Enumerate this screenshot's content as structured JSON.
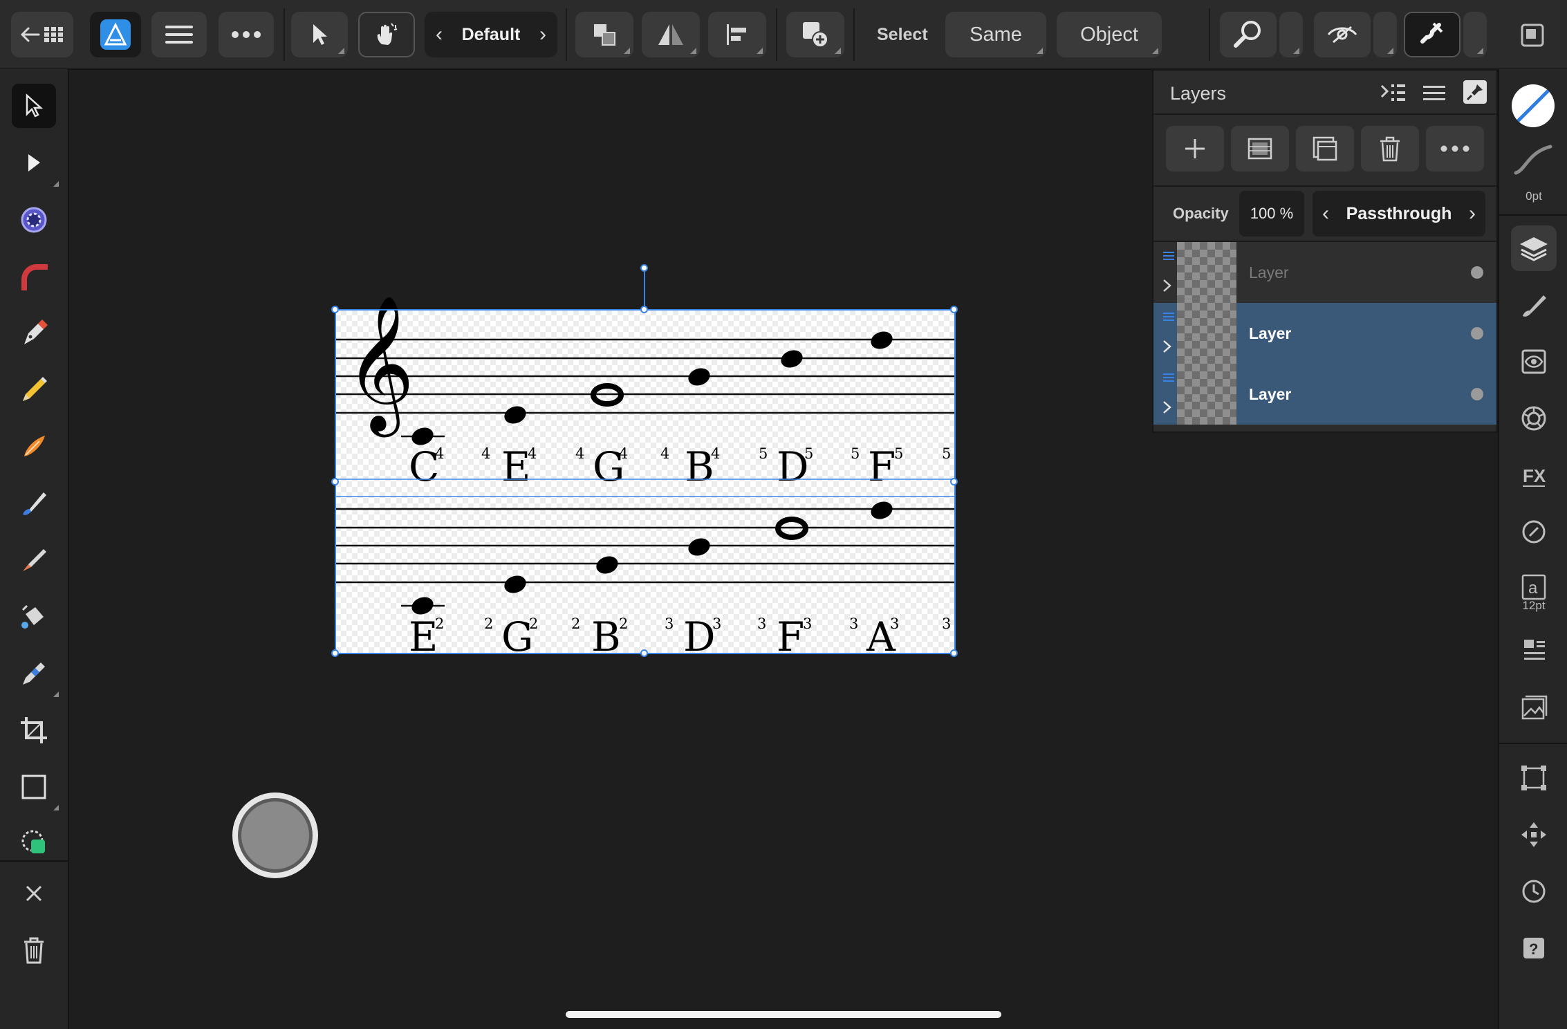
{
  "toolbar": {
    "persona": "Default",
    "select_label": "Select",
    "same_label": "Same",
    "object_label": "Object",
    "menu_icon": "hamburger-icon",
    "more_icon": "ellipsis-icon"
  },
  "layers_panel": {
    "title": "Layers",
    "opacity_label": "Opacity",
    "opacity_value": "100 %",
    "blend_mode": "Passthrough",
    "layers": [
      {
        "name": "Layer",
        "selected": false,
        "dimmed": true
      },
      {
        "name": "Layer",
        "selected": true,
        "dimmed": false
      },
      {
        "name": "Layer",
        "selected": true,
        "dimmed": false
      }
    ]
  },
  "right_studio": {
    "stroke_width": "0pt",
    "text_size": "12pt"
  },
  "sheet": {
    "staff1": {
      "notes": [
        {
          "letter": "C",
          "octave": "4"
        },
        {
          "letter": "E",
          "octave": "4"
        },
        {
          "letter": "G",
          "octave": "4"
        },
        {
          "letter": "B",
          "octave": "4"
        },
        {
          "letter": "D",
          "octave": "5"
        },
        {
          "letter": "F",
          "octave": "5"
        }
      ],
      "loose": [
        "4",
        "4",
        "4",
        "5",
        "5",
        "5"
      ]
    },
    "staff2": {
      "notes": [
        {
          "letter": "E",
          "octave": "2"
        },
        {
          "letter": "G",
          "octave": "2"
        },
        {
          "letter": "B",
          "octave": "2"
        },
        {
          "letter": "D",
          "octave": "3"
        },
        {
          "letter": "F",
          "octave": "3"
        },
        {
          "letter": "A",
          "octave": "3"
        }
      ],
      "loose": [
        "2",
        "2",
        "3",
        "3",
        "3",
        "3"
      ]
    },
    "clef_glyph": "𝄞"
  },
  "colors": {
    "accent_blue": "#3a83e6",
    "selected_layer": "#3a5878",
    "app_icon": "#2f8fe6"
  }
}
